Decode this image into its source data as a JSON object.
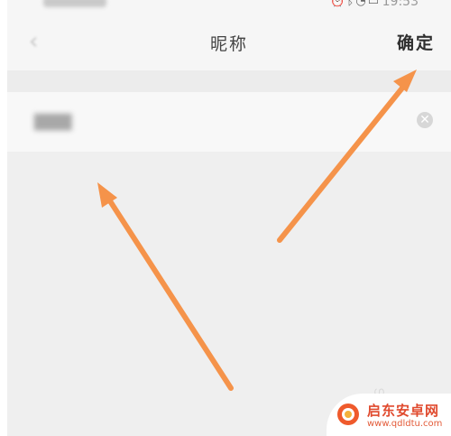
{
  "status_bar": {
    "time": "19:53",
    "icons": [
      "alarm-icon",
      "bluetooth-icon",
      "signal-icon",
      "battery-icon"
    ]
  },
  "nav": {
    "back_label": "‹",
    "title": "昵称",
    "confirm_label": "确定"
  },
  "input": {
    "value": "▇▇▇"
  },
  "watermark": {
    "title": "启东安卓网",
    "url": "www.qdldtu.com"
  },
  "colors": {
    "accent_arrow": "#f5934a",
    "watermark_red": "#e04a2e",
    "background": "#efefef"
  }
}
